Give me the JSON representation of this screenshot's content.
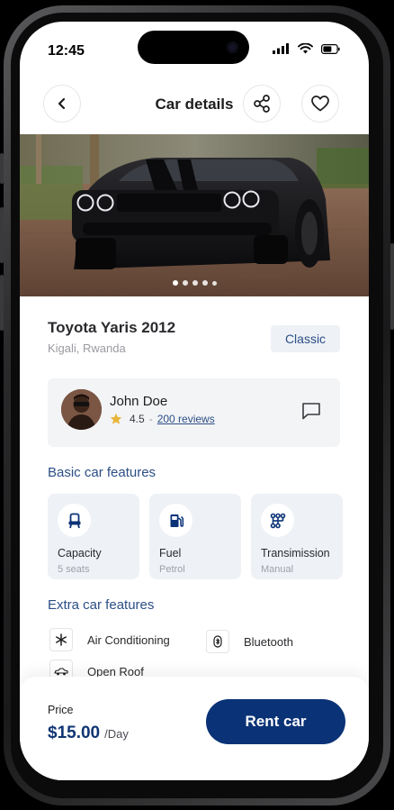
{
  "status_bar": {
    "time": "12:45"
  },
  "header": {
    "title": "Car details"
  },
  "gallery": {
    "dots": 5,
    "active_index": 0
  },
  "car": {
    "name": "Toyota Yaris 2012",
    "location": "Kigali, Rwanda",
    "category": "Classic"
  },
  "owner": {
    "name": "John Doe",
    "rating": "4.5",
    "separator": "-",
    "reviews": "200 reviews"
  },
  "basic_features": {
    "title": "Basic car features",
    "items": [
      {
        "name": "Capacity",
        "value": "5 seats",
        "icon": "seat-icon"
      },
      {
        "name": "Fuel",
        "value": "Petrol",
        "icon": "fuel-pump-icon"
      },
      {
        "name": "Transimission",
        "value": "Manual",
        "icon": "gear-shift-icon"
      }
    ]
  },
  "extra_features": {
    "title": "Extra car features",
    "items": [
      {
        "label": "Air Conditioning",
        "icon": "snowflake-icon"
      },
      {
        "label": "Bluetooth",
        "icon": "bluetooth-icon"
      },
      {
        "label": "Open Roof",
        "icon": "convertible-car-icon"
      }
    ]
  },
  "booking": {
    "price_label": "Price",
    "price": "$15.00",
    "unit": "/Day",
    "rent_label": "Rent car"
  },
  "colors": {
    "primary": "#0a3276",
    "accent_text": "#2c4f86",
    "card_bg": "#eef1f6",
    "star": "#e8b63a"
  }
}
